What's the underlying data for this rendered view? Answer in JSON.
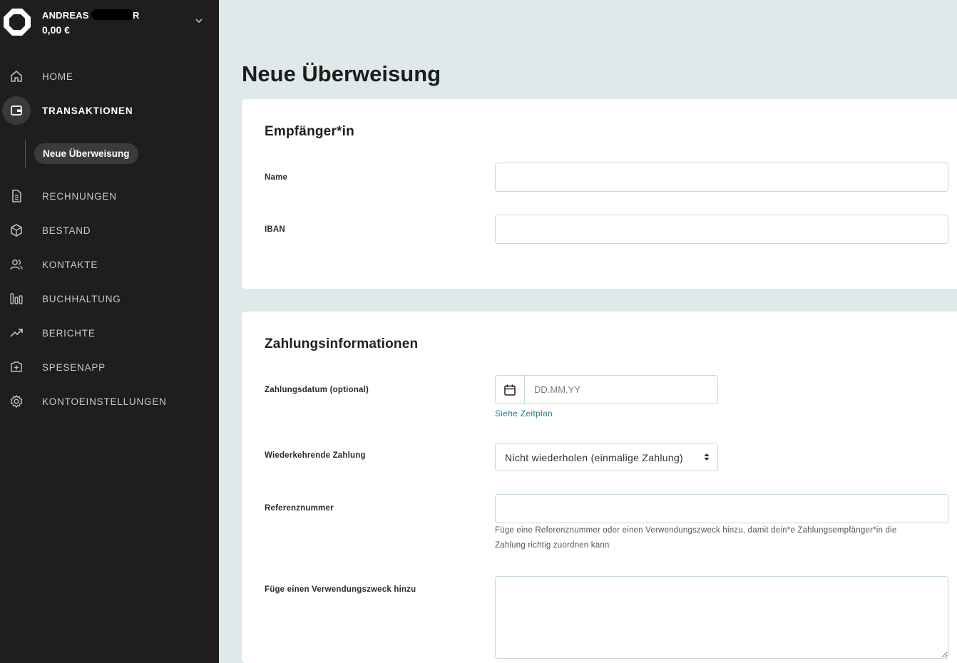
{
  "account": {
    "name": "ANDREAS",
    "name_suffix": "R",
    "balance": "0,00 €"
  },
  "nav": {
    "home": "HOME",
    "transaktionen": "TRANSAKTIONEN",
    "sub_neue_ueberweisung": "Neue Überweisung",
    "rechnungen": "RECHNUNGEN",
    "bestand": "BESTAND",
    "kontakte": "KONTAKTE",
    "buchhaltung": "BUCHHALTUNG",
    "berichte": "BERICHTE",
    "spesenapp": "SPESENAPP",
    "kontoeinstellungen": "KONTOEINSTELLUNGEN"
  },
  "page": {
    "title": "Neue Überweisung"
  },
  "recipient": {
    "title": "Empfänger*in",
    "name_label": "Name",
    "name_value": "",
    "iban_label": "IBAN",
    "iban_value": ""
  },
  "payment": {
    "title": "Zahlungsinformationen",
    "date_label": "Zahlungsdatum (optional)",
    "date_placeholder": "DD.MM.YY",
    "schedule_link": "Siehe Zeitplan",
    "recurring_label": "Wiederkehrende Zahlung",
    "recurring_value": "Nicht wiederholen (einmalige Zahlung)",
    "reference_label": "Referenznummer",
    "reference_value": "",
    "reference_hint_line1": "Füge eine Referenznummer oder einen Verwendungszweck hinzu, damit dein*e Zahlungsempfänger*in die",
    "reference_hint_line2": "Zahlung richtig zuordnen kann",
    "purpose_label": "Füge einen Verwendungszweck hinzu",
    "purpose_value": ""
  },
  "colors": {
    "sidebar_bg": "#1e1e1e",
    "page_bg": "#dfe9ea",
    "input_border": "#c5dad8",
    "link": "#1f7f87"
  },
  "icons": {
    "logo": "octagon-logo",
    "chevron": "chevron-down-icon",
    "calendar": "calendar-icon"
  }
}
